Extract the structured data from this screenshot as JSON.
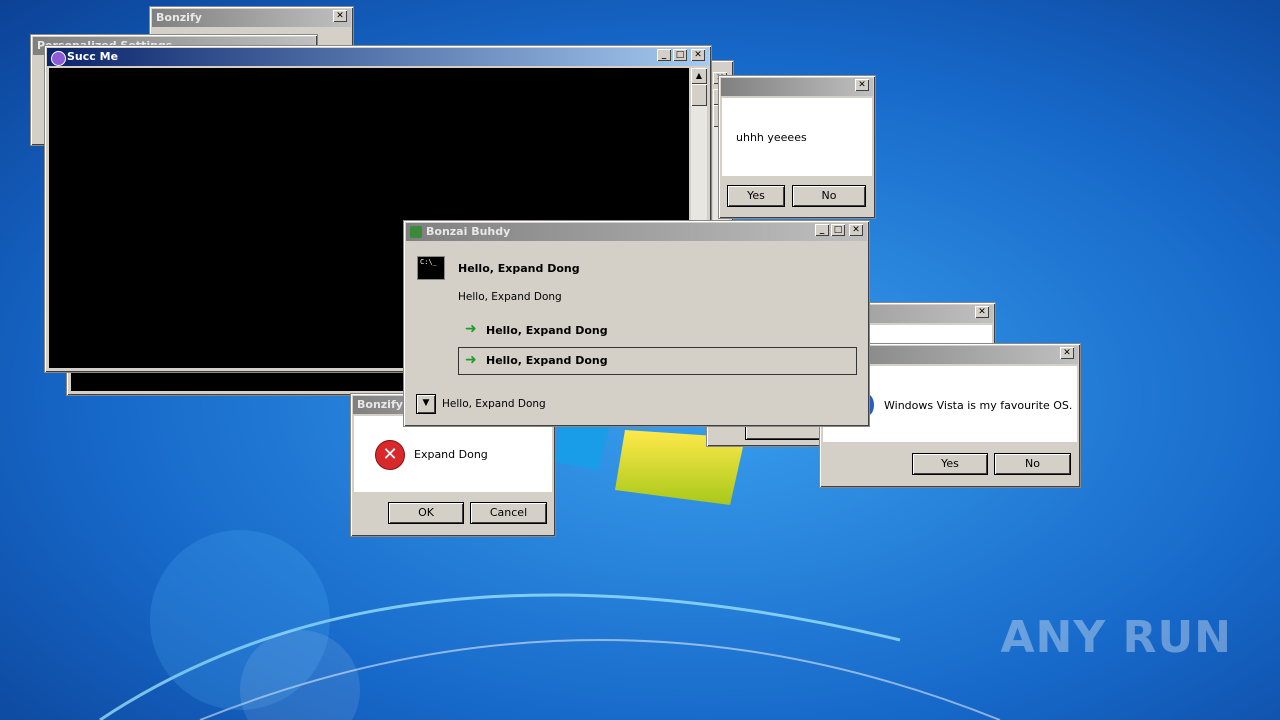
{
  "windows": {
    "bonzify_top": {
      "title": "Bonzify"
    },
    "personalized_settings": {
      "title": "Personalized Settings"
    },
    "succ_me": {
      "title": "Succ Me"
    },
    "uhhh_dialog": {
      "message": "uhhh yeeees",
      "yes_label": "Yes",
      "no_label": "No"
    },
    "bonzai_buhdy": {
      "title": "Bonzai Buhdy",
      "main_instruction": "Hello, Expand Dong",
      "content": "Hello, Expand Dong",
      "command_link_1": "Hello, Expand Dong",
      "command_link_2": "Hello, Expand Dong",
      "expando_text": "Hello, Expand Dong"
    },
    "bonzify_error": {
      "title": "Bonzify",
      "message": "Expand Dong",
      "ok_label": "OK",
      "cancel_label": "Cancel"
    },
    "vista_dialog": {
      "message": "Windows Vista is my favourite OS.",
      "yes_label": "Yes",
      "no_label": "No"
    }
  },
  "watermark": {
    "text": "ANY RUN"
  },
  "colors": {
    "desktop_blue": "#1a6fd0",
    "active_title": "#0a246a",
    "inactive_title": "#808080"
  }
}
